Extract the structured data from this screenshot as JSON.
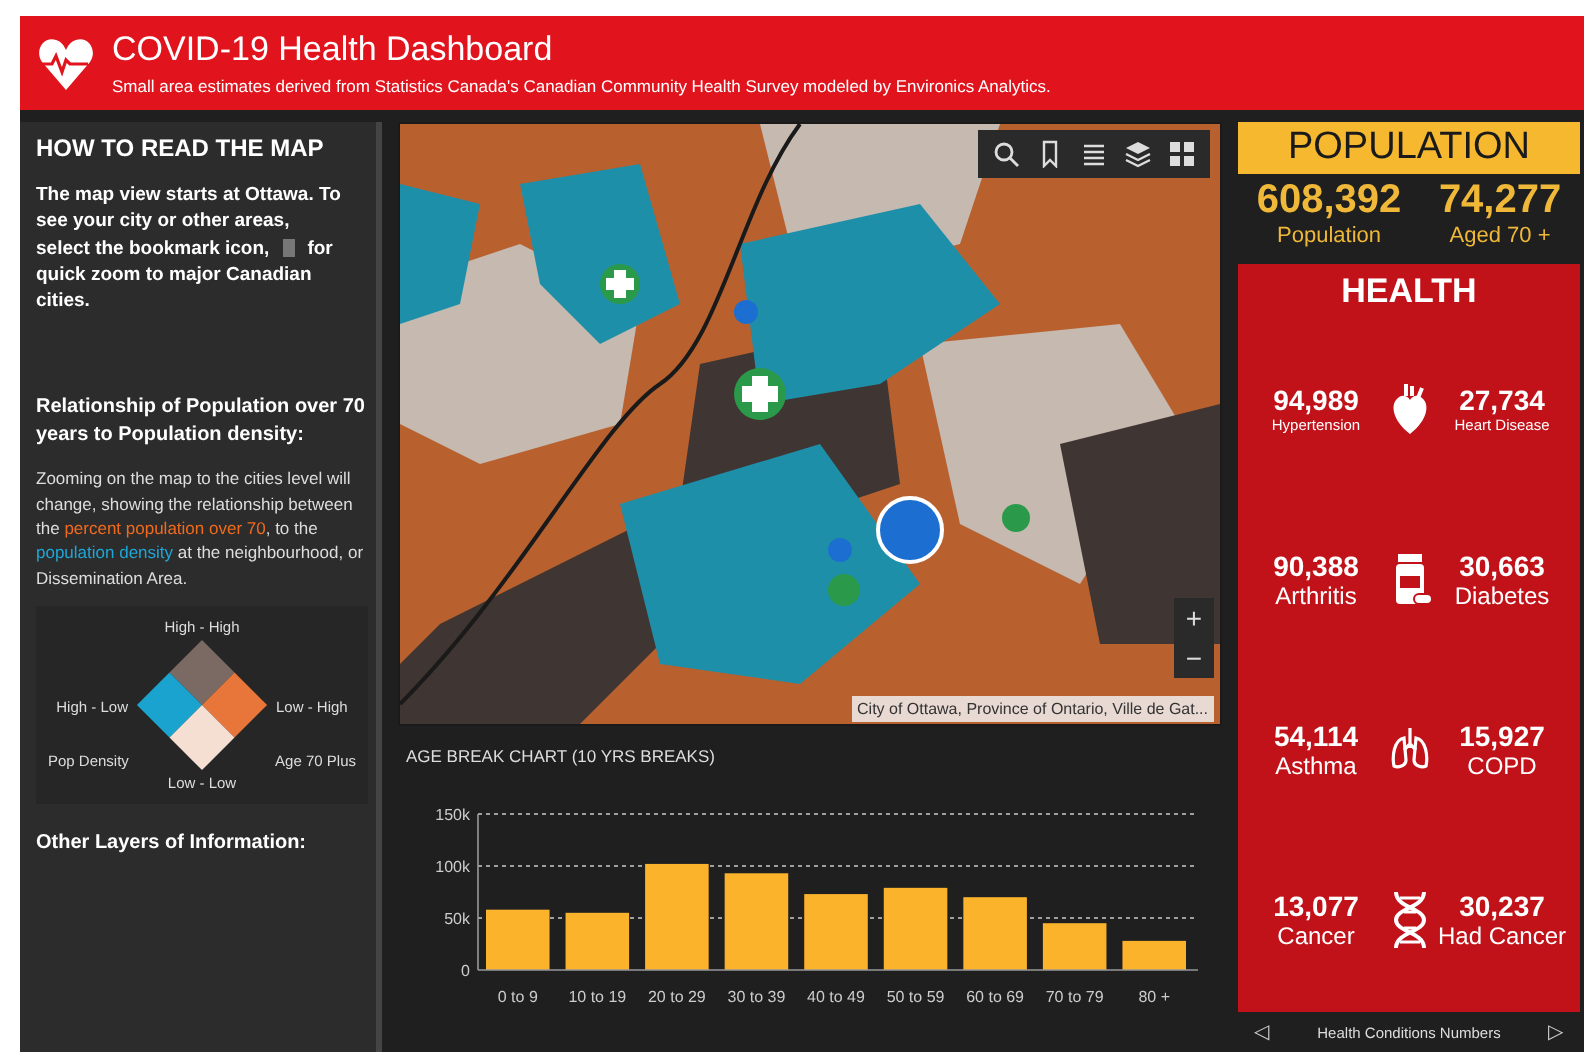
{
  "header": {
    "title": "COVID-19 Health Dashboard",
    "subtitle": "Small area estimates derived from Statistics Canada's Canadian Community Health Survey modeled by Environics Analytics."
  },
  "guide": {
    "heading": "HOW TO READ THE MAP",
    "intro_first": "The map view starts at Ottawa. To see your city or other areas,",
    "intro_before": "select the bookmark icon,",
    "intro_after": "for",
    "intro_last": "quick zoom to major Canadian cities.",
    "subheading": "Relationship of Population over 70 years to Population density:",
    "body": [
      {
        "kind": "plain",
        "text": "Zooming on the map to the cities level will change, showing the relationship between the "
      },
      {
        "kind": "age",
        "text": "percent population over 70"
      },
      {
        "kind": "plain",
        "text": ", to the "
      },
      {
        "kind": "density",
        "text": "population density"
      },
      {
        "kind": "plain",
        "text": " at the neighbourhood, or Dissemination Area."
      }
    ],
    "legend": {
      "top": "High - High",
      "left": "High - Low",
      "right": "Low - High",
      "bottom": "Low - Low",
      "axis_left": "Pop Density",
      "axis_right": "Age 70 Plus"
    },
    "footer_heading": "Other Layers of Information:"
  },
  "map": {
    "kind": "picture",
    "attribution": "City of Ottawa, Province of Ontario, Ville de Gat...",
    "zoom_in": "+",
    "zoom_out": "−"
  },
  "age_chart": {
    "title": "AGE BREAK CHART (10 YRS BREAKS)",
    "chart_data": {
      "type": "bar",
      "categories": [
        "0 to 9",
        "10 to 19",
        "20 to 29",
        "30 to 39",
        "40 to 49",
        "50 to 59",
        "60 to 69",
        "70 to 79",
        "80 +"
      ],
      "series": [
        {
          "color": "#fbb32c",
          "values": [
            58000,
            55000,
            102000,
            93000,
            73000,
            79000,
            70000,
            45000,
            28000
          ]
        }
      ],
      "ylim": [
        0,
        150000
      ],
      "yticks": [
        {
          "value": 0,
          "label": "0"
        },
        {
          "value": 50000,
          "label": "50k"
        },
        {
          "value": 100000,
          "label": "100k"
        },
        {
          "value": 150000,
          "label": "150k"
        }
      ]
    }
  },
  "population": {
    "heading": "POPULATION",
    "stats": [
      {
        "value": "608,392",
        "label": "Population"
      },
      {
        "value": "74,277",
        "label": "Aged 70 +"
      }
    ]
  },
  "health": {
    "heading": "HEALTH",
    "rows": [
      {
        "left": {
          "value": "94,989",
          "label": "Hypertension"
        },
        "right": {
          "value": "27,734",
          "label": "Heart Disease"
        }
      },
      {
        "left": {
          "value": "90,388",
          "label": "Arthritis"
        },
        "right": {
          "value": "30,663",
          "label": "Diabetes"
        }
      },
      {
        "left": {
          "value": "54,114",
          "label": "Asthma"
        },
        "right": {
          "value": "15,927",
          "label": "COPD"
        }
      },
      {
        "left": {
          "value": "13,077",
          "label": "Cancer"
        },
        "right": {
          "value": "30,237",
          "label": "Had Cancer"
        }
      }
    ],
    "footer": {
      "prev": "◁",
      "title": "Health Conditions Numbers",
      "next": "▷"
    }
  }
}
